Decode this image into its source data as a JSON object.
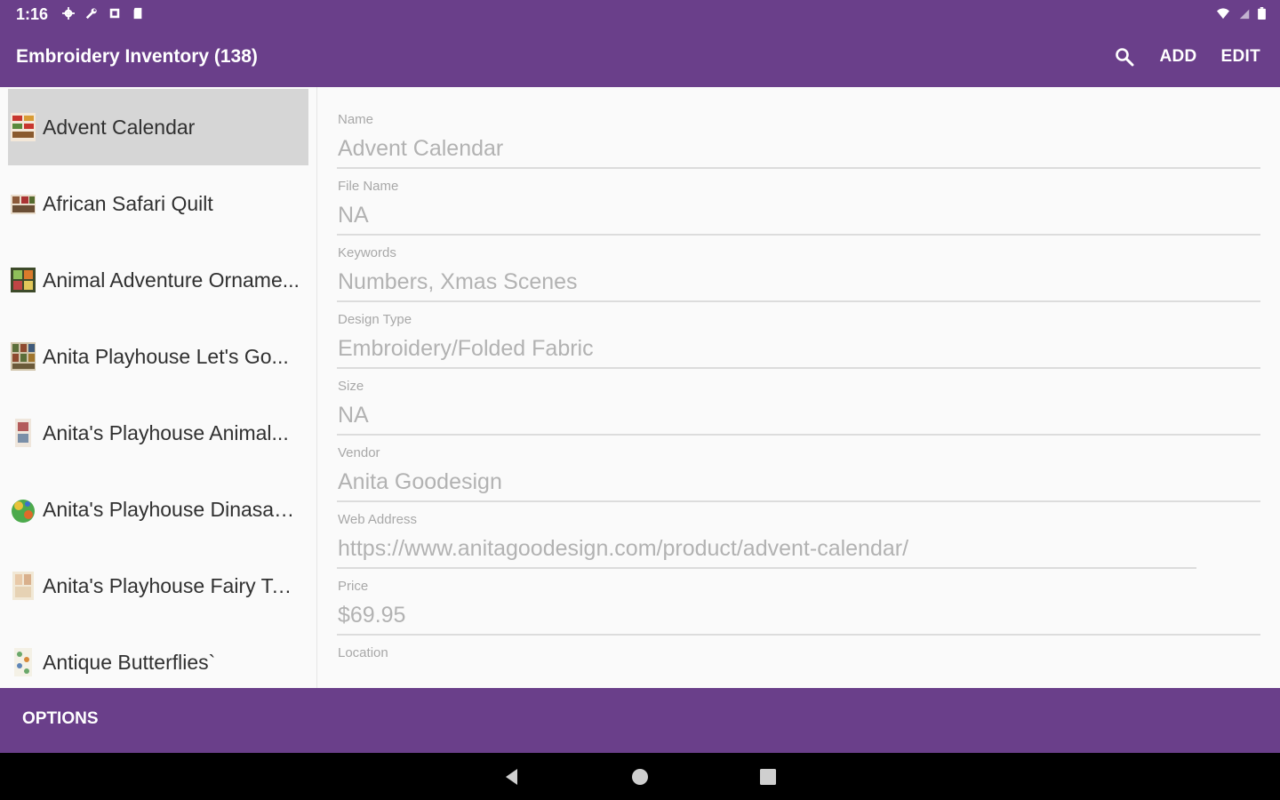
{
  "status_bar": {
    "time": "1:16",
    "left_icons": [
      "settings-icon",
      "wrench-icon",
      "notification-icon",
      "sd-card-icon"
    ],
    "right_icons": [
      "wifi-icon",
      "cell-signal-icon",
      "battery-icon"
    ]
  },
  "app_bar": {
    "title": "Embroidery Inventory (138)",
    "search_icon": "search-icon",
    "add_label": "ADD",
    "edit_label": "EDIT",
    "color": "#6a3f8a"
  },
  "list": {
    "items": [
      {
        "label": "Advent Calendar",
        "selected": true
      },
      {
        "label": "African Safari Quilt"
      },
      {
        "label": "Animal Adventure Orname..."
      },
      {
        "label": "Anita Playhouse Let's Go..."
      },
      {
        "label": "Anita's Playhouse Animal..."
      },
      {
        "label": "Anita's Playhouse Dinasau..."
      },
      {
        "label": "Anita's Playhouse Fairy Tai..."
      },
      {
        "label": "Antique Butterflies`"
      }
    ]
  },
  "detail": {
    "fields": [
      {
        "label": "Name",
        "value": "Advent Calendar"
      },
      {
        "label": "File Name",
        "value": "NA"
      },
      {
        "label": "Keywords",
        "value": "Numbers, Xmas Scenes"
      },
      {
        "label": "Design Type",
        "value": "Embroidery/Folded Fabric"
      },
      {
        "label": "Size",
        "value": "NA"
      },
      {
        "label": "Vendor",
        "value": "Anita Goodesign"
      },
      {
        "label": "Web Address",
        "value": "https://www.anitagoodesign.com/product/advent-calendar/"
      },
      {
        "label": "Price",
        "value": "$69.95"
      },
      {
        "label": "Location",
        "value": ""
      }
    ]
  },
  "bottom_bar": {
    "options_label": "OPTIONS"
  },
  "nav_bar": {
    "icons": [
      "back-icon",
      "home-icon",
      "recents-icon"
    ]
  }
}
